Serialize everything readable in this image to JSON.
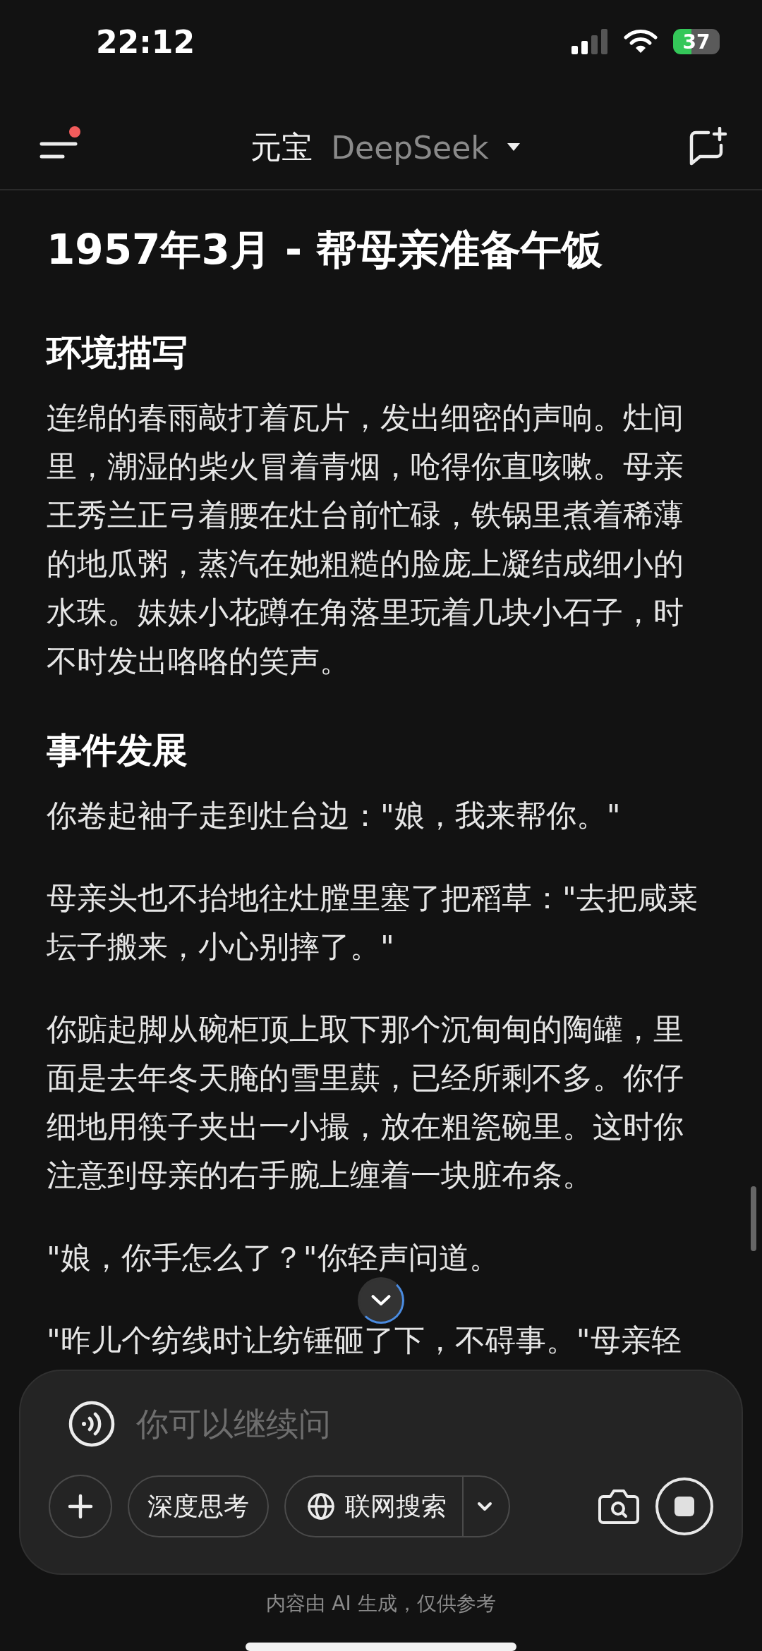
{
  "status_bar": {
    "time": "22:12",
    "battery": "37"
  },
  "nav": {
    "has_notification": true,
    "app": "元宝",
    "model": "DeepSeek"
  },
  "article": {
    "title": "1957年3月 - 帮母亲准备午饭",
    "sections": [
      {
        "heading": "环境描写",
        "paragraphs": [
          "连绵的春雨敲打着瓦片，发出细密的声响。灶间里，潮湿的柴火冒着青烟，呛得你直咳嗽。母亲王秀兰正弓着腰在灶台前忙碌，铁锅里煮着稀薄的地瓜粥，蒸汽在她粗糙的脸庞上凝结成细小的水珠。妹妹小花蹲在角落里玩着几块小石子，时不时发出咯咯的笑声。"
        ]
      },
      {
        "heading": "事件发展",
        "paragraphs": [
          "你卷起袖子走到灶台边：\"娘，我来帮你。\"",
          "母亲头也不抬地往灶膛里塞了把稻草：\"去把咸菜坛子搬来，小心别摔了。\"",
          "你踮起脚从碗柜顶上取下那个沉甸甸的陶罐，里面是去年冬天腌的雪里蕻，已经所剩不多。你仔细地用筷子夹出一小撮，放在粗瓷碗里。这时你注意到母亲的右手腕上缠着一块脏布条。",
          "\"娘，你手怎么了？\"你轻声问道。",
          "\"昨儿个纺线时让纺锤砸了下，不碍事。\"母亲轻"
        ]
      }
    ]
  },
  "composer": {
    "placeholder": "你可以继续问",
    "chips": [
      "深度思考",
      "联网搜索"
    ]
  },
  "footer": "内容由 AI 生成，仅供参考"
}
